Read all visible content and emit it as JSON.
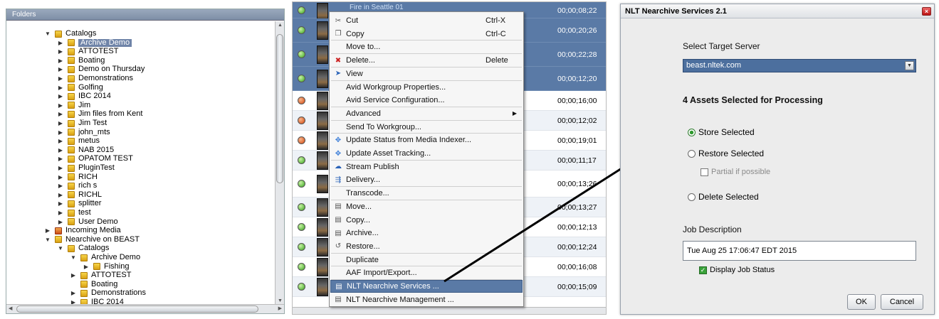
{
  "folders_pane": {
    "header": "Folders",
    "tree": [
      {
        "label": "Catalogs",
        "indent": 0,
        "state": "expanded",
        "selected": false,
        "special": false
      },
      {
        "label": "Archive Demo",
        "indent": 1,
        "state": "collapsed",
        "selected": true,
        "special": false
      },
      {
        "label": "ATTOTEST",
        "indent": 1,
        "state": "collapsed",
        "selected": false,
        "special": false
      },
      {
        "label": "Boating",
        "indent": 1,
        "state": "collapsed",
        "selected": false,
        "special": false
      },
      {
        "label": "Demo on Thursday",
        "indent": 1,
        "state": "collapsed",
        "selected": false,
        "special": false
      },
      {
        "label": "Demonstrations",
        "indent": 1,
        "state": "collapsed",
        "selected": false,
        "special": false
      },
      {
        "label": "Golfing",
        "indent": 1,
        "state": "collapsed",
        "selected": false,
        "special": false
      },
      {
        "label": "IBC 2014",
        "indent": 1,
        "state": "collapsed",
        "selected": false,
        "special": false
      },
      {
        "label": "Jim",
        "indent": 1,
        "state": "collapsed",
        "selected": false,
        "special": false
      },
      {
        "label": "Jim files from Kent",
        "indent": 1,
        "state": "collapsed",
        "selected": false,
        "special": false
      },
      {
        "label": "Jim Test",
        "indent": 1,
        "state": "collapsed",
        "selected": false,
        "special": false
      },
      {
        "label": "john_mts",
        "indent": 1,
        "state": "collapsed",
        "selected": false,
        "special": false
      },
      {
        "label": "metus",
        "indent": 1,
        "state": "collapsed",
        "selected": false,
        "special": false
      },
      {
        "label": "NAB 2015",
        "indent": 1,
        "state": "collapsed",
        "selected": false,
        "special": false
      },
      {
        "label": "OPATOM TEST",
        "indent": 1,
        "state": "collapsed",
        "selected": false,
        "special": false
      },
      {
        "label": "PluginTest",
        "indent": 1,
        "state": "collapsed",
        "selected": false,
        "special": false
      },
      {
        "label": "RICH",
        "indent": 1,
        "state": "collapsed",
        "selected": false,
        "special": false
      },
      {
        "label": "rich s",
        "indent": 1,
        "state": "collapsed",
        "selected": false,
        "special": false
      },
      {
        "label": "RICHL",
        "indent": 1,
        "state": "collapsed",
        "selected": false,
        "special": false
      },
      {
        "label": "splitter",
        "indent": 1,
        "state": "collapsed",
        "selected": false,
        "special": false
      },
      {
        "label": "test",
        "indent": 1,
        "state": "collapsed",
        "selected": false,
        "special": false
      },
      {
        "label": "User Demo",
        "indent": 1,
        "state": "collapsed",
        "selected": false,
        "special": false
      },
      {
        "label": "Incoming Media",
        "indent": 0,
        "state": "collapsed",
        "selected": false,
        "special": true
      },
      {
        "label": "Nearchive on BEAST",
        "indent": 0,
        "state": "expanded",
        "selected": false,
        "special": false
      },
      {
        "label": "Catalogs",
        "indent": 1,
        "state": "expanded",
        "selected": false,
        "special": false
      },
      {
        "label": "Archive Demo",
        "indent": 2,
        "state": "expanded",
        "selected": false,
        "special": false
      },
      {
        "label": "Fishing",
        "indent": 3,
        "state": "collapsed",
        "selected": false,
        "special": false
      },
      {
        "label": "ATTOTEST",
        "indent": 2,
        "state": "collapsed",
        "selected": false,
        "special": false
      },
      {
        "label": "Boating",
        "indent": 2,
        "state": "none",
        "selected": false,
        "special": false
      },
      {
        "label": "Demonstrations",
        "indent": 2,
        "state": "collapsed",
        "selected": false,
        "special": false
      },
      {
        "label": "IBC 2014",
        "indent": 2,
        "state": "collapsed",
        "selected": false,
        "special": false
      }
    ]
  },
  "asset_list": {
    "rows": [
      {
        "status": "green",
        "timecode": "00;00;08;22",
        "name": "Fire in Seattle 01",
        "selected": true
      },
      {
        "status": "green",
        "timecode": "00;00;20;26",
        "name": "",
        "selected": true
      },
      {
        "status": "green",
        "timecode": "00;00;22;28",
        "name": "",
        "selected": true
      },
      {
        "status": "green",
        "timecode": "00;00;12;20",
        "name": "",
        "selected": true
      },
      {
        "status": "red",
        "timecode": "00;00;16;00",
        "name": "",
        "selected": false
      },
      {
        "status": "red",
        "timecode": "00;00;12;02",
        "name": "",
        "selected": false
      },
      {
        "status": "red",
        "timecode": "00;00;19;01",
        "name": "",
        "selected": false
      },
      {
        "status": "green",
        "timecode": "00;00;11;17",
        "name": "",
        "selected": false
      },
      {
        "status": "green",
        "timecode": "00;00;13;26",
        "name": "",
        "selected": false
      },
      {
        "status": "green",
        "timecode": "00;00;13;27",
        "name": "",
        "selected": false
      },
      {
        "status": "green",
        "timecode": "00;00;12;13",
        "name": "",
        "selected": false
      },
      {
        "status": "green",
        "timecode": "00;00;12;24",
        "name": "",
        "selected": false
      },
      {
        "status": "green",
        "timecode": "00;00;16;08",
        "name": "",
        "selected": false
      },
      {
        "status": "green",
        "timecode": "00;00;15;09",
        "name": "",
        "selected": false
      }
    ]
  },
  "context_menu": {
    "items": [
      {
        "label": "Cut",
        "shortcut": "Ctrl-X",
        "icon": "scissors-icon",
        "submenu": false
      },
      {
        "label": "Copy",
        "shortcut": "Ctrl-C",
        "icon": "copy-icon",
        "submenu": false
      },
      {
        "label": "Move to...",
        "shortcut": "",
        "icon": "",
        "submenu": false
      },
      {
        "label": "Delete...",
        "shortcut": "Delete",
        "icon": "delete-icon",
        "submenu": false
      },
      {
        "label": "View",
        "shortcut": "",
        "icon": "view-icon",
        "submenu": false
      },
      {
        "label": "Avid Workgroup Properties...",
        "shortcut": "",
        "icon": "",
        "submenu": false
      },
      {
        "label": "Avid Service Configuration...",
        "shortcut": "",
        "icon": "",
        "submenu": false
      },
      {
        "label": "Advanced",
        "shortcut": "",
        "icon": "",
        "submenu": true
      },
      {
        "label": "Send To Workgroup...",
        "shortcut": "",
        "icon": "",
        "submenu": false
      },
      {
        "label": "Update Status from Media Indexer...",
        "shortcut": "",
        "icon": "puzzle-icon",
        "submenu": false
      },
      {
        "label": "Update Asset Tracking...",
        "shortcut": "",
        "icon": "puzzle-icon",
        "submenu": false
      },
      {
        "label": "Stream Publish",
        "shortcut": "",
        "icon": "stream-icon",
        "submenu": false
      },
      {
        "label": "Delivery...",
        "shortcut": "",
        "icon": "delivery-icon",
        "submenu": false
      },
      {
        "label": "Transcode...",
        "shortcut": "",
        "icon": "",
        "submenu": false
      },
      {
        "label": "Move...",
        "shortcut": "",
        "icon": "service-icon",
        "submenu": false
      },
      {
        "label": "Copy...",
        "shortcut": "",
        "icon": "service-icon",
        "submenu": false
      },
      {
        "label": "Archive...",
        "shortcut": "",
        "icon": "service-icon",
        "submenu": false
      },
      {
        "label": "Restore...",
        "shortcut": "",
        "icon": "restore-icon",
        "submenu": false
      },
      {
        "label": "Duplicate",
        "shortcut": "",
        "icon": "",
        "submenu": false
      },
      {
        "label": "AAF Import/Export...",
        "shortcut": "",
        "icon": "",
        "submenu": false
      },
      {
        "label": "NLT Nearchive Services ...",
        "shortcut": "",
        "icon": "service-icon",
        "submenu": false
      },
      {
        "label": "NLT Nearchive Management ...",
        "shortcut": "",
        "icon": "service-icon",
        "submenu": false
      }
    ]
  },
  "dialog": {
    "title": "NLT Nearchive Services 2.1",
    "target_server_label": "Select Target Server",
    "target_server_value": "beast.nltek.com",
    "assets_selected": "4 Assets Selected for Processing",
    "store_label": "Store Selected",
    "restore_label": "Restore Selected",
    "partial_label": "Partial if possible",
    "delete_label": "Delete Selected",
    "job_description_label": "Job Description",
    "job_description_value": "Tue Aug 25 17:06:47 EDT 2015",
    "display_job_status_label": "Display Job Status",
    "ok_label": "OK",
    "cancel_label": "Cancel"
  },
  "colors": {
    "selection_blue": "#5a7aa6",
    "status_green": "#36a21c",
    "status_red": "#d1460d",
    "arrow": "#000000"
  }
}
